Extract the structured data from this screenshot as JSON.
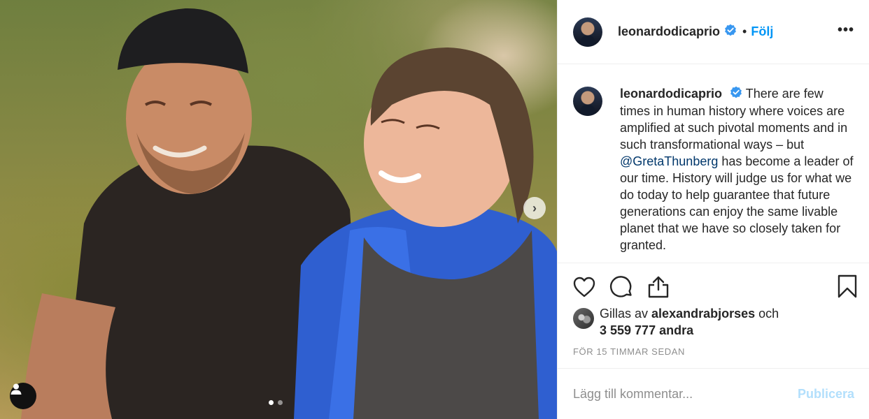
{
  "post": {
    "carousel": {
      "page_count": 2,
      "current_page": 1,
      "next_icon": "chevron-right-icon"
    },
    "tag_icon": "user-icon"
  },
  "header": {
    "username": "leonardodicaprio",
    "verified_icon": "verified-badge-icon",
    "separator": "•",
    "follow_label": "Följ",
    "more_icon": "ellipsis-icon",
    "more_glyph": "•••"
  },
  "caption": {
    "username": "leonardodicaprio",
    "text_before": "There are few times in human history where voices are amplified at such pivotal moments and in such transformational ways – but ",
    "mention": "@GretaThunberg",
    "text_after": " has become a leader of our time. History will judge us for what we do today to help guarantee that future generations can enjoy the same livable planet that we have so closely taken for granted."
  },
  "actions": {
    "like_icon": "heart-icon",
    "comment_icon": "comment-icon",
    "share_icon": "share-icon",
    "save_icon": "bookmark-icon"
  },
  "likes": {
    "prefix": "Gillas av",
    "first_user": "alexandrabjorses",
    "conjunction": "och",
    "count": "3 559 777 andra"
  },
  "timestamp": "FÖR 15 TIMMAR SEDAN",
  "comment": {
    "placeholder": "Lägg till kommentar...",
    "publish_label": "Publicera"
  },
  "colors": {
    "accent": "#0095f6",
    "verified": "#3897f0",
    "publish_disabled": "#b2dffc",
    "mention": "#00376b",
    "muted": "#8e8e8e"
  }
}
